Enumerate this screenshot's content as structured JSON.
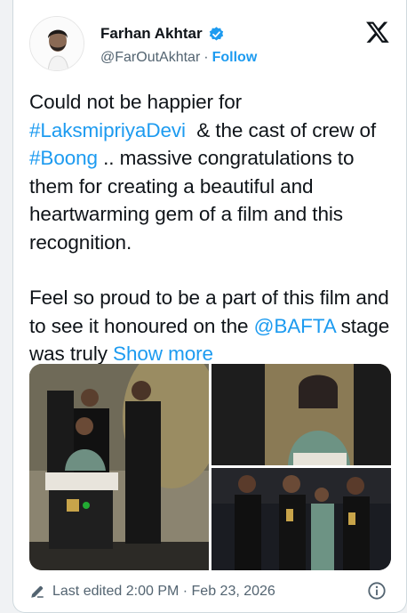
{
  "author": {
    "name": "Farhan Akhtar",
    "handle": "@FarOutAkhtar",
    "separator": "·",
    "follow_label": "Follow",
    "verified_icon": "verified-badge-icon",
    "platform_icon": "x-logo-icon"
  },
  "tweet": {
    "line1": "Could not be happier for",
    "hashtag1": "#LaksmipriyaDevi",
    "text2": "  & the cast of crew of ",
    "hashtag2": "#Boong",
    "text3": " .. massive congratulations to them for creating a beautiful and heartwarming gem of a film and this recognition.",
    "para2": "Feel so proud to be a part of this film and to see it honoured on the ",
    "mention": "@BAFTA",
    "text4": " stage was truly ",
    "show_more": "Show more"
  },
  "footer": {
    "edited_label": "Last edited 2:00 PM · Feb 23, 2026",
    "edit_icon": "pencil-icon",
    "info_icon": "info-icon"
  },
  "colors": {
    "link": "#1d9bf0",
    "secondary_text": "#536471",
    "text": "#0f1419"
  }
}
